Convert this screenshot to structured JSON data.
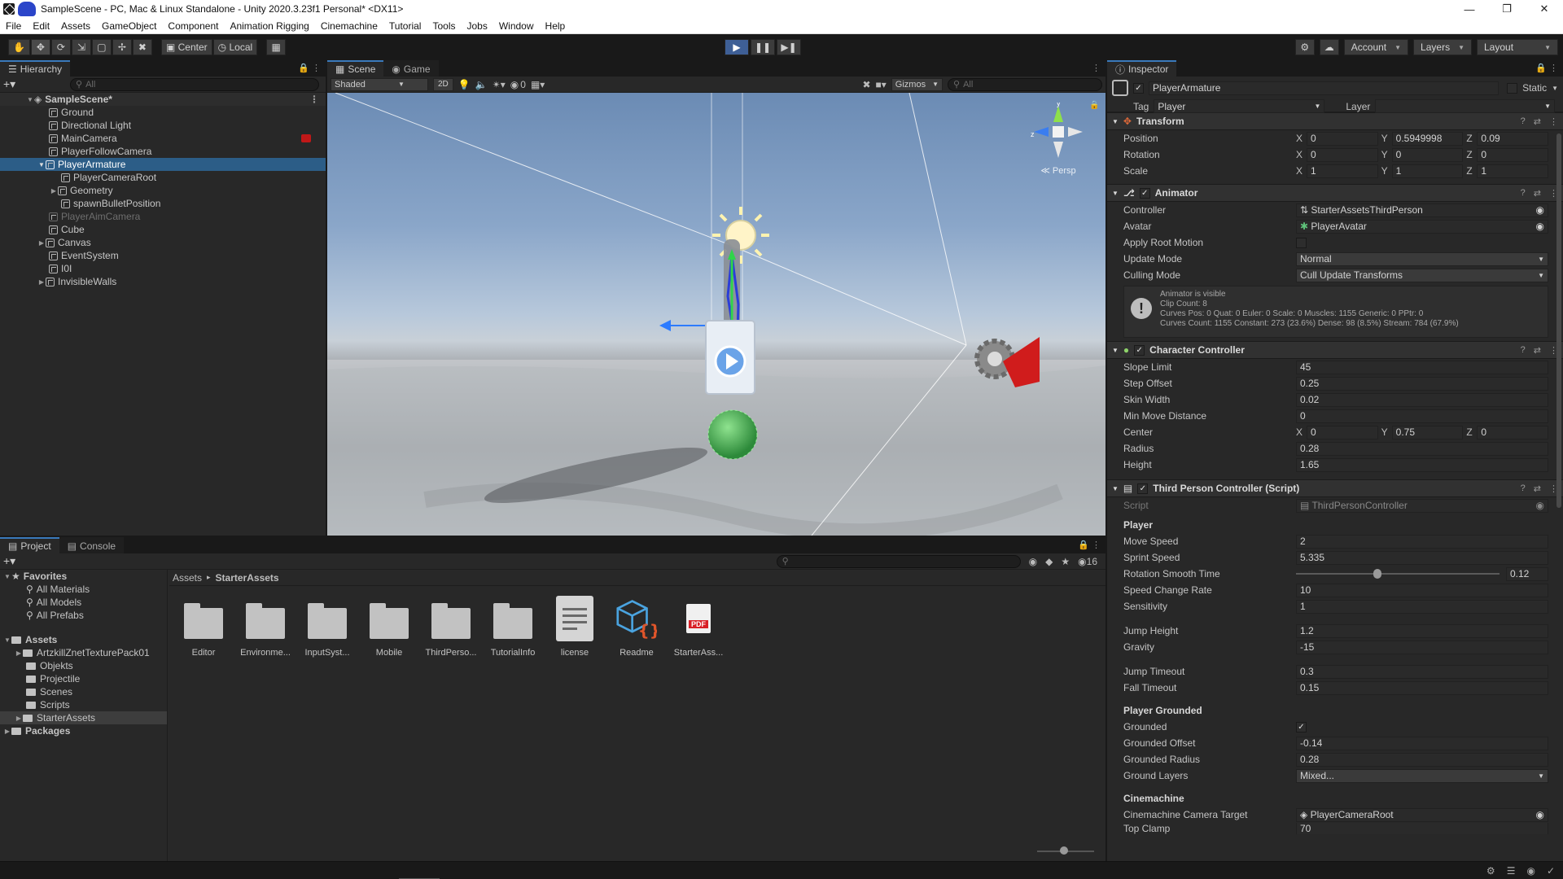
{
  "window": {
    "title": "SampleScene - PC, Mac & Linux Standalone - Unity 2020.3.23f1 Personal* <DX11>"
  },
  "menu": [
    "File",
    "Edit",
    "Assets",
    "GameObject",
    "Component",
    "Animation Rigging",
    "Cinemachine",
    "Tutorial",
    "Tools",
    "Jobs",
    "Window",
    "Help"
  ],
  "toolbar": {
    "pivot": "Center",
    "space": "Local",
    "account": "Account",
    "layers": "Layers",
    "layout": "Layout"
  },
  "hierarchy": {
    "tab": "Hierarchy",
    "search_placeholder": "All",
    "scene": "SampleScene*",
    "items": [
      {
        "label": "Ground",
        "indent": 1
      },
      {
        "label": "Directional Light",
        "indent": 1
      },
      {
        "label": "MainCamera",
        "indent": 1
      },
      {
        "label": "PlayerFollowCamera",
        "indent": 1
      },
      {
        "label": "PlayerArmature",
        "indent": 1
      },
      {
        "label": "PlayerCameraRoot",
        "indent": 2
      },
      {
        "label": "Geometry",
        "indent": 2
      },
      {
        "label": "spawnBulletPosition",
        "indent": 2
      },
      {
        "label": "PlayerAimCamera",
        "indent": 1
      },
      {
        "label": "Cube",
        "indent": 1
      },
      {
        "label": "Canvas",
        "indent": 1
      },
      {
        "label": "EventSystem",
        "indent": 1
      },
      {
        "label": "I0I",
        "indent": 1
      },
      {
        "label": "InvisibleWalls",
        "indent": 1
      }
    ]
  },
  "scene": {
    "tab_scene": "Scene",
    "tab_game": "Game",
    "shading": "Shaded",
    "mode_2d": "2D",
    "hidden_count": "0",
    "gizmos": "Gizmos",
    "search_placeholder": "All",
    "persp": "Persp"
  },
  "inspector": {
    "tab": "Inspector",
    "object_name": "PlayerArmature",
    "static": "Static",
    "tag_label": "Tag",
    "tag": "Player",
    "layer_label": "Layer",
    "transform": {
      "title": "Transform",
      "position": {
        "label": "Position",
        "x": "0",
        "y": "0.5949998",
        "z": "0.09"
      },
      "rotation": {
        "label": "Rotation",
        "x": "0",
        "y": "0",
        "z": "0"
      },
      "scale": {
        "label": "Scale",
        "x": "1",
        "y": "1",
        "z": "1"
      }
    },
    "animator": {
      "title": "Animator",
      "controller_label": "Controller",
      "controller": "StarterAssetsThirdPerson",
      "avatar_label": "Avatar",
      "avatar": "PlayerAvatar",
      "root_motion_label": "Apply Root Motion",
      "update_mode_label": "Update Mode",
      "update_mode": "Normal",
      "culling_label": "Culling Mode",
      "culling": "Cull Update Transforms",
      "info": [
        "Animator is visible",
        "Clip Count: 8",
        "Curves Pos: 0 Quat: 0 Euler: 0 Scale: 0 Muscles: 1155 Generic: 0 PPtr: 0",
        "Curves Count: 1155 Constant: 273 (23.6%) Dense: 98 (8.5%) Stream: 784 (67.9%)"
      ]
    },
    "character_controller": {
      "title": "Character Controller",
      "slope_label": "Slope Limit",
      "slope": "45",
      "step_label": "Step Offset",
      "step": "0.25",
      "skin_label": "Skin Width",
      "skin": "0.02",
      "minmove_label": "Min Move Distance",
      "minmove": "0",
      "center_label": "Center",
      "center_x": "0",
      "center_y": "0.75",
      "center_z": "0",
      "radius_label": "Radius",
      "radius": "0.28",
      "height_label": "Height",
      "height": "1.65"
    },
    "tpc": {
      "title": "Third Person Controller (Script)",
      "script_label": "Script",
      "script": "ThirdPersonController",
      "player_section": "Player",
      "move_speed_label": "Move Speed",
      "move_speed": "2",
      "sprint_speed_label": "Sprint Speed",
      "sprint_speed": "5.335",
      "rotation_label": "Rotation Smooth Time",
      "rotation": "0.12",
      "rotation_fraction": 0.4,
      "speed_change_label": "Speed Change Rate",
      "speed_change": "10",
      "sensitivity_label": "Sensitivity",
      "sensitivity": "1",
      "jump_height_label": "Jump Height",
      "jump_height": "1.2",
      "gravity_label": "Gravity",
      "gravity": "-15",
      "jump_timeout_label": "Jump Timeout",
      "jump_timeout": "0.3",
      "fall_timeout_label": "Fall Timeout",
      "fall_timeout": "0.15",
      "grounded_section": "Player Grounded",
      "grounded_label": "Grounded",
      "grounded_offset_label": "Grounded Offset",
      "grounded_offset": "-0.14",
      "grounded_radius_label": "Grounded Radius",
      "grounded_radius": "0.28",
      "ground_layers_label": "Ground Layers",
      "ground_layers": "Mixed...",
      "cinemachine_section": "Cinemachine",
      "cam_target_label": "Cinemachine Camera Target",
      "cam_target": "PlayerCameraRoot",
      "top_clamp_label": "Top Clamp",
      "top_clamp": "70"
    }
  },
  "project": {
    "tab_project": "Project",
    "tab_console": "Console",
    "hidden_count": "16",
    "favorites": "Favorites",
    "favorite_items": [
      "All Materials",
      "All Models",
      "All Prefabs"
    ],
    "assets_root": "Assets",
    "asset_folders": [
      "ArtzkillZnetTexturePack01",
      "Objekts",
      "Projectile",
      "Scenes",
      "Scripts",
      "StarterAssets"
    ],
    "packages": "Packages",
    "breadcrumb": [
      "Assets",
      "StarterAssets"
    ],
    "grid": [
      {
        "name": "Editor",
        "kind": "folder"
      },
      {
        "name": "Environme...",
        "kind": "folder"
      },
      {
        "name": "InputSyst...",
        "kind": "folder"
      },
      {
        "name": "Mobile",
        "kind": "folder"
      },
      {
        "name": "ThirdPerso...",
        "kind": "folder"
      },
      {
        "name": "TutorialInfo",
        "kind": "folder"
      },
      {
        "name": "license",
        "kind": "text"
      },
      {
        "name": "Readme",
        "kind": "readme"
      },
      {
        "name": "StarterAss...",
        "kind": "pdf"
      }
    ],
    "pdf_label": "PDF"
  },
  "colors": {
    "selection": "#2c5d87",
    "accent": "#3a79bb",
    "play": "#3e5f96"
  }
}
